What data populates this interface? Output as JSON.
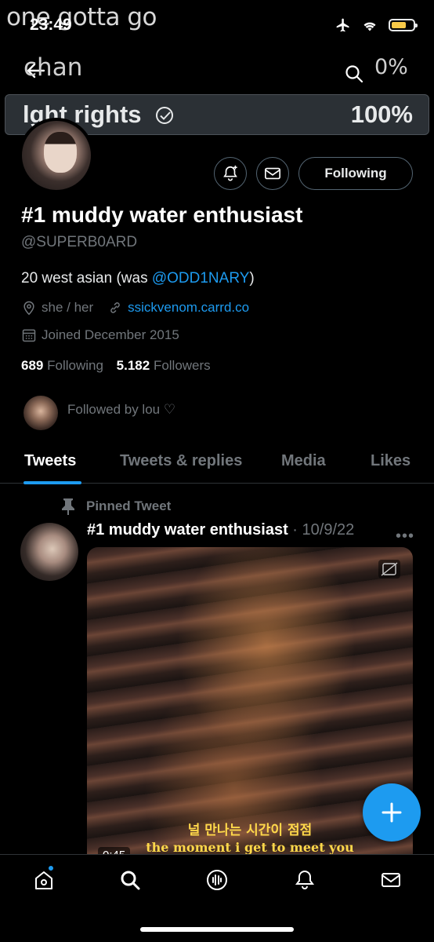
{
  "overlay": {
    "caption": "one gotta go"
  },
  "status_bar": {
    "time": "23:49"
  },
  "top_bar": {
    "name": "chan",
    "percent": "0%"
  },
  "poll_option": {
    "label": "lght rights",
    "percent": "100%"
  },
  "profile": {
    "display_name": "#1 muddy water enthusiast",
    "handle": "@SUPERB0ARD",
    "bio_prefix": "20 west asian (was ",
    "bio_link": "@ODD1NARY",
    "bio_suffix": ")",
    "pronouns": "she / her",
    "website": "ssickvenom.carrd.co",
    "joined": "Joined December 2015",
    "following_count": "689",
    "following_label": "Following",
    "followers_count": "5.182",
    "followers_label": "Followers",
    "followed_by": "Followed by lou ♡",
    "follow_button": "Following"
  },
  "tabs": [
    {
      "label": "Tweets",
      "active": true
    },
    {
      "label": "Tweets & replies",
      "active": false
    },
    {
      "label": "Media",
      "active": false
    },
    {
      "label": "Likes",
      "active": false
    }
  ],
  "pinned_tweet": {
    "pinned_label": "Pinned Tweet",
    "author": "#1 muddy water enthusiast",
    "separator": " · ",
    "date": "10/9/22",
    "subtitle_ko": "널 만나는 시간이 점점",
    "subtitle_en": "the moment i get to meet you",
    "video_time": "0:45"
  },
  "colors": {
    "accent": "#1d9bf0",
    "background": "#000000",
    "muted": "#71767b"
  },
  "icons": [
    "back-arrow-icon",
    "search-icon",
    "airplane-icon",
    "wifi-icon",
    "battery-icon",
    "notification-bell-plus-icon",
    "mail-icon",
    "location-icon",
    "link-icon",
    "calendar-icon",
    "pin-icon",
    "more-icon",
    "cc-icon",
    "compose-plus-icon",
    "home-icon",
    "spaces-icon",
    "bell-icon"
  ]
}
